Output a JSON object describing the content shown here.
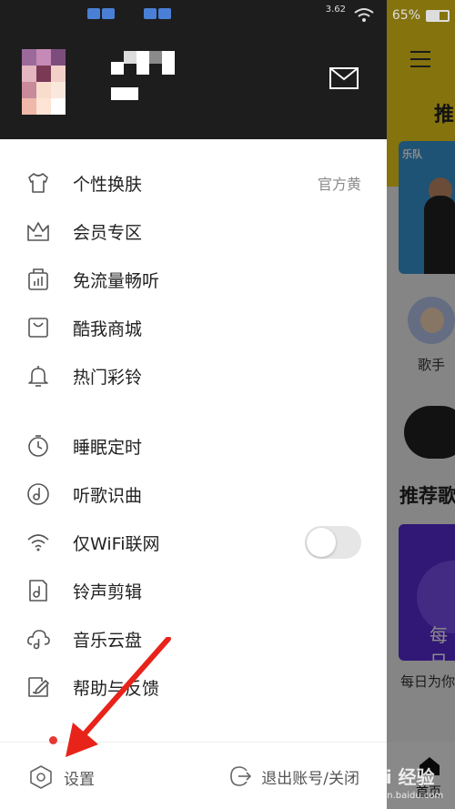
{
  "status_bar": {
    "network_speed": "3.62",
    "battery": "65%"
  },
  "drawer": {
    "menu_group_1": [
      {
        "icon": "tshirt-icon",
        "label": "个性换肤",
        "value": "官方黄"
      },
      {
        "icon": "crown-icon",
        "label": "会员专区"
      },
      {
        "icon": "data-traffic-icon",
        "label": "免流量畅听"
      },
      {
        "icon": "shop-bag-icon",
        "label": "酷我商城"
      },
      {
        "icon": "bell-icon",
        "label": "热门彩铃"
      }
    ],
    "menu_group_2": [
      {
        "icon": "timer-icon",
        "label": "睡眠定时"
      },
      {
        "icon": "music-recognize-icon",
        "label": "听歌识曲"
      },
      {
        "icon": "wifi-icon",
        "label": "仅WiFi联网",
        "toggle": false
      },
      {
        "icon": "ringtone-edit-icon",
        "label": "铃声剪辑"
      },
      {
        "icon": "cloud-music-icon",
        "label": "音乐云盘"
      },
      {
        "icon": "feedback-icon",
        "label": "帮助与反馈"
      }
    ],
    "footer": {
      "settings_label": "设置",
      "logout_label": "退出账号/关闭"
    }
  },
  "background_app": {
    "tab_label": "推",
    "singer_label": "歌手",
    "section_title": "推荐歌",
    "card_text": "每日",
    "card_caption": "每日为你",
    "bottom_nav_label": "首页"
  },
  "watermark": {
    "text": "Bai 经验",
    "sub": "jingyan.baidu.com"
  },
  "colors": {
    "accent_yellow": "#f2d21a",
    "annotation_red": "#e8231a",
    "toggle_off": "#e6e6e6"
  }
}
